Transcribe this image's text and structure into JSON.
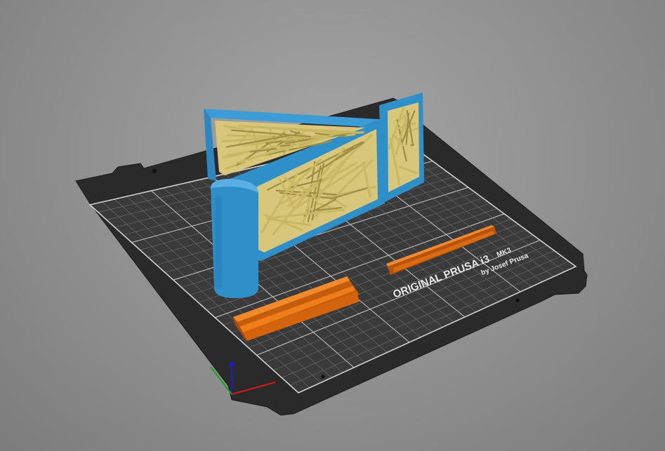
{
  "bed": {
    "title": "ORIGINAL PRUSA i3",
    "model": "MK3",
    "subtitle": "by Josef Prusa"
  },
  "colors": {
    "background": "#8f8f8f",
    "bed_plate": "#2b2b2b",
    "grid": "#7a7a7a",
    "object_blue": "#2f8fc9",
    "object_support": "#d8c77a",
    "object_orange": "#e06e10",
    "axis_x": "#d21a1a",
    "axis_y": "#19a319",
    "axis_z": "#1a1ad2"
  },
  "objects": [
    {
      "name": "hinged-frame-part",
      "color": "object_blue"
    },
    {
      "name": "support-structures",
      "color": "object_support"
    },
    {
      "name": "orange-rail-large",
      "color": "object_orange"
    },
    {
      "name": "orange-rail-small",
      "color": "object_orange"
    }
  ]
}
